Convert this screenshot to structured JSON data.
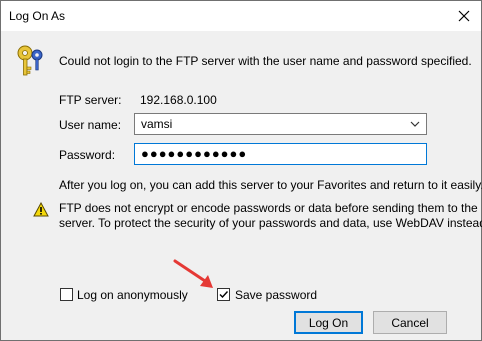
{
  "window": {
    "title": "Log On As"
  },
  "message": "Could not login to the FTP server with the user name and password specified.",
  "server": {
    "label": "FTP server:",
    "value": "192.168.0.100"
  },
  "username": {
    "label": "User name:",
    "value": "vamsi"
  },
  "password": {
    "label": "Password:",
    "masked": "●●●●●●●●●●●●"
  },
  "info": "After you log on, you can add this server to your Favorites and return to it easily.",
  "warning": {
    "line1": "FTP does not encrypt or encode passwords or data before sending them to the",
    "line2": "server.  To protect the security of your passwords and data, use WebDAV instead."
  },
  "options": {
    "anonymous_label": "Log on anonymously",
    "anonymous_checked": false,
    "save_password_label": "Save password",
    "save_password_checked": true
  },
  "buttons": {
    "logon": "Log On",
    "cancel": "Cancel"
  },
  "icons": {
    "keys": "keys-icon",
    "warning": "warning-icon",
    "close": "close-icon",
    "dropdown": "chevron-down-icon",
    "annotation": "red-arrow-annotation"
  },
  "colors": {
    "focus": "#0078d7",
    "annotation": "#e53935",
    "warning": "#f5d90a"
  }
}
